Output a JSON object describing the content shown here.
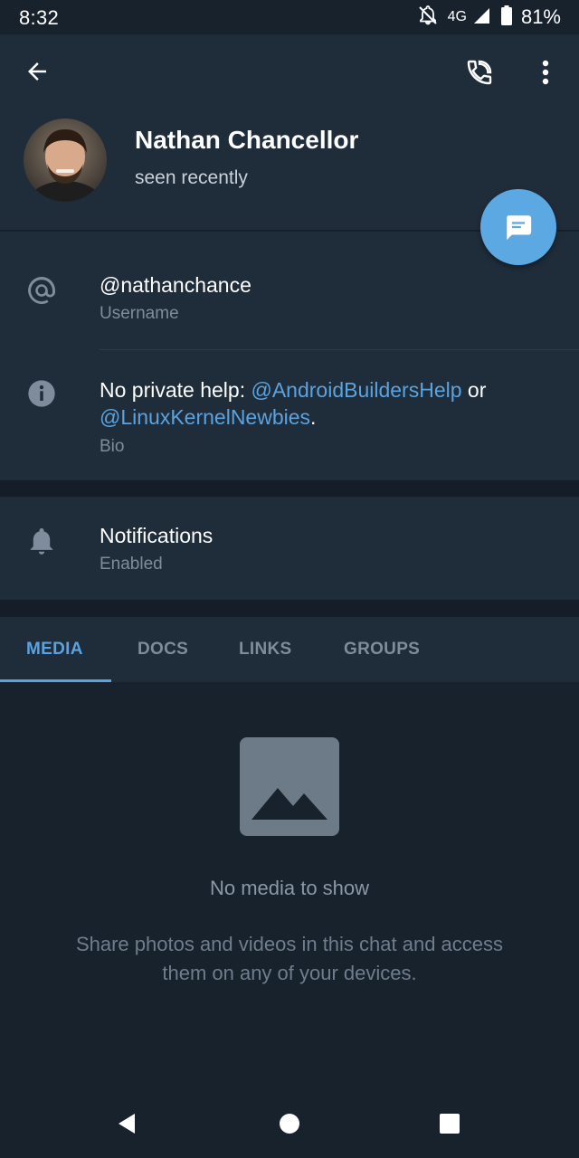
{
  "status_bar": {
    "time": "8:32",
    "network": "4G",
    "battery": "81%",
    "icons": [
      "notifications-off-icon",
      "signal-icon",
      "battery-icon"
    ]
  },
  "header": {
    "name": "Nathan Chancellor",
    "status": "seen recently",
    "actions": [
      "back-arrow-icon",
      "phone-icon",
      "more-vert-icon"
    ],
    "fab_icon": "message-icon"
  },
  "info": {
    "username": {
      "value": "@nathanchance",
      "label": "Username",
      "icon": "at-sign-icon"
    },
    "bio": {
      "prefix": "No private help: ",
      "link1": "@AndroidBuildersHelp",
      "middle": " or",
      "link2": "@LinuxKernelNewbies",
      "suffix": ".",
      "label": "Bio",
      "icon": "info-icon"
    }
  },
  "notifications": {
    "title": "Notifications",
    "value": "Enabled",
    "icon": "bell-icon"
  },
  "tabs": [
    {
      "label": "MEDIA",
      "active": true
    },
    {
      "label": "DOCS",
      "active": false
    },
    {
      "label": "LINKS",
      "active": false
    },
    {
      "label": "GROUPS",
      "active": false
    }
  ],
  "empty_state": {
    "icon": "image-placeholder-icon",
    "title": "No media to show",
    "description": "Share photos and videos in this chat and access them on any of your devices."
  },
  "nav_bar": [
    "back-triangle-icon",
    "home-circle-icon",
    "recents-square-icon"
  ],
  "colors": {
    "background": "#18222d",
    "surface": "#1f2c3a",
    "accent": "#5ba3e0",
    "fab": "#5ca8e2"
  }
}
